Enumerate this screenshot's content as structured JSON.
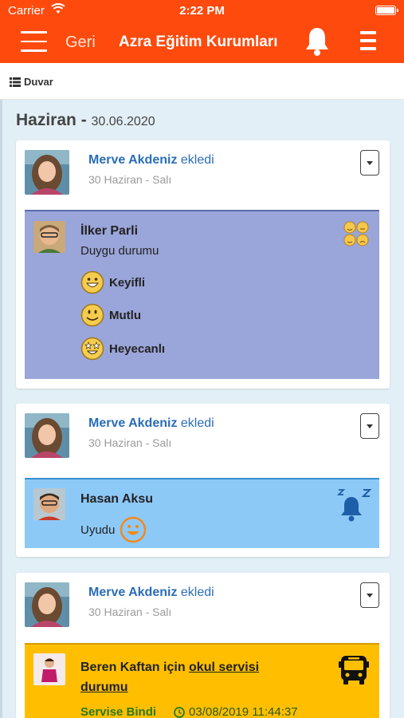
{
  "status": {
    "carrier": "Carrier",
    "time": "2:22 PM"
  },
  "navbar": {
    "back": "Geri",
    "title": "Azra Eğitim Kurumları"
  },
  "subbar": {
    "wall": "Duvar"
  },
  "section": {
    "month": "Haziran",
    "separator": " - ",
    "date": "30.06.2020"
  },
  "posts": [
    {
      "author": "Merve Akdeniz",
      "action": " ekledi",
      "date": "30 Haziran - Salı",
      "panel": {
        "bg": "#9aa5d9",
        "name": "İlker Parli",
        "subtitle": "Duygu durumu",
        "moods": [
          "Keyifli",
          "Mutlu",
          "Heyecanlı"
        ],
        "icon": "emotions-icon"
      }
    },
    {
      "author": "Merve Akdeniz",
      "action": " ekledi",
      "date": "30 Haziran - Salı",
      "panel": {
        "bg": "#8dc9f7",
        "name": "Hasan Aksu",
        "subtitle": "Uyudu",
        "icon": "sleep-bell-icon"
      }
    },
    {
      "author": "Merve Akdeniz",
      "action": " ekledi",
      "date": "30 Haziran - Salı",
      "panel": {
        "bg": "#ffbf00",
        "name_prefix": "Beren Kaftan için ",
        "link_line1": "okul servisi",
        "link_line2": "durumu",
        "status": "Servise Bindi",
        "timestamp": "03/08/2019 11:44:37",
        "icon": "bus-icon"
      }
    }
  ],
  "colors": {
    "accent": "#ff4a0d",
    "link": "#2a6db8"
  }
}
